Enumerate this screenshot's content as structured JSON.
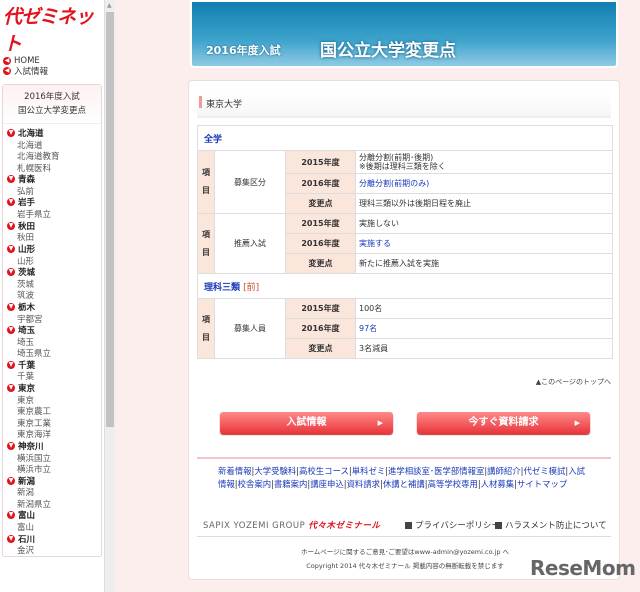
{
  "sidebar": {
    "logo": "代ゼミネット",
    "home": "HOME",
    "nyushi": "入試情報",
    "box_title1": "2016年度入試",
    "box_title2": "国公立大学変更点",
    "prefs": [
      {
        "name": "北海道",
        "unis": [
          "北海道",
          "北海道教育",
          "札幌医科"
        ]
      },
      {
        "name": "青森",
        "unis": [
          "弘前"
        ]
      },
      {
        "name": "岩手",
        "unis": [
          "岩手県立"
        ]
      },
      {
        "name": "秋田",
        "unis": [
          "秋田"
        ]
      },
      {
        "name": "山形",
        "unis": [
          "山形"
        ]
      },
      {
        "name": "茨城",
        "unis": [
          "茨城",
          "筑波"
        ]
      },
      {
        "name": "栃木",
        "unis": [
          "宇都宮"
        ]
      },
      {
        "name": "埼玉",
        "unis": [
          "埼玉",
          "埼玉県立"
        ]
      },
      {
        "name": "千葉",
        "unis": [
          "千葉"
        ]
      },
      {
        "name": "東京",
        "unis": [
          "東京",
          "東京農工",
          "東京工業",
          "東京海洋"
        ]
      },
      {
        "name": "神奈川",
        "unis": [
          "横浜国立",
          "横浜市立"
        ]
      },
      {
        "name": "新潟",
        "unis": [
          "新潟",
          "新潟県立"
        ]
      },
      {
        "name": "富山",
        "unis": [
          "富山"
        ]
      },
      {
        "name": "石川",
        "unis": [
          "金沢"
        ]
      }
    ]
  },
  "banner": {
    "year": "2016年度入試",
    "title": "国公立大学変更点"
  },
  "university": "東京大学",
  "table": {
    "item_label": "項目",
    "y2015": "2015年度",
    "y2016": "2016年度",
    "change": "変更点",
    "sections": [
      {
        "title": "全学",
        "bracket": "",
        "items": [
          {
            "name": "募集区分",
            "v2015": "分離分割(前期･後期)",
            "v2015b": "※後期は理科三類を除く",
            "v2016": "分離分割(前期のみ)",
            "change": "理科三類以外は後期日程を廃止"
          },
          {
            "name": "推薦入試",
            "v2015": "実施しない",
            "v2015b": "",
            "v2016": "実施する",
            "change": "新たに推薦入試を実施"
          }
        ]
      },
      {
        "title": "理科三類",
        "bracket": "[前]",
        "items": [
          {
            "name": "募集人員",
            "v2015": "100名",
            "v2015b": "",
            "v2016": "97名",
            "change": "3名減員"
          }
        ]
      }
    ]
  },
  "page_top": "▲このページのトップへ",
  "buttons": {
    "nyushi": "入試情報",
    "request": "今すぐ資料請求"
  },
  "footer": {
    "links": [
      "新着情報",
      "大学受験科",
      "高校生コース",
      "単科ゼミ",
      "進学相談室･医学部情報室",
      "講師紹介",
      "代ゼミ模試",
      "入試情報",
      "校舎案内",
      "書籍案内",
      "講座申込",
      "資料請求",
      "休講と補講",
      "高等学校専用",
      "人材募集",
      "サイトマップ"
    ],
    "group": "SAPIX YOZEMI GROUP",
    "brand": "代々木ゼミナール",
    "privacy": "プライバシーポリシー",
    "harassment": "ハラスメント防止について",
    "contact": "ホームページに関するご意見･ご要望はwww-admin@yozemi.co.jp へ",
    "copyright": "Copyright 2014 代々木ゼミナール 掲載内容の無断転載を禁じます"
  },
  "watermark": "ReseMom"
}
